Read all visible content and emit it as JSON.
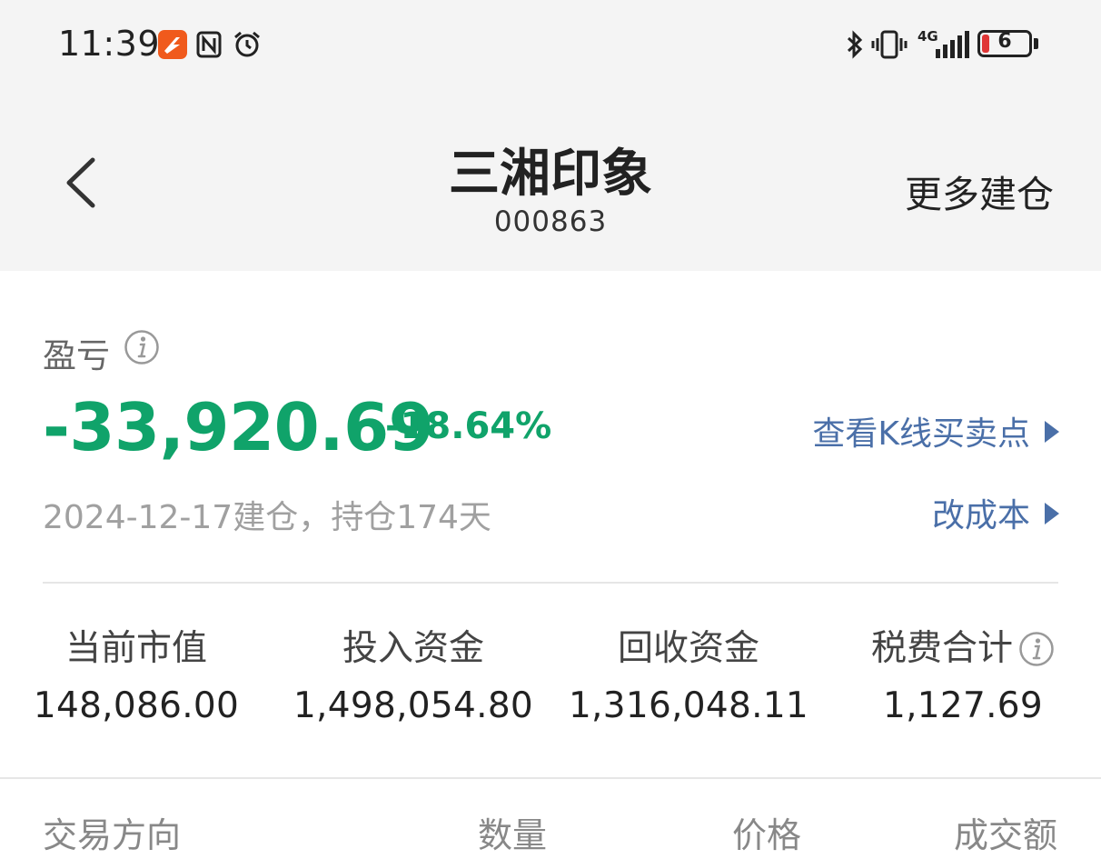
{
  "status_bar": {
    "time": "11:39",
    "network": "4G",
    "battery_level": "6",
    "icons": [
      "app-notification-icon",
      "nfc-icon",
      "alarm-icon",
      "bluetooth-icon",
      "vibrate-icon",
      "signal-icon",
      "battery-icon"
    ]
  },
  "nav": {
    "title": "三湘印象",
    "code": "000863",
    "right_action": "更多建仓"
  },
  "pnl": {
    "label": "盈亏",
    "value": "-33,920.69",
    "percent": "-18.64%",
    "kline_link": "查看K线买卖点",
    "hold_info": "2024-12-17建仓，持仓174天",
    "cost_link": "改成本",
    "color": "#10a36a"
  },
  "stats": [
    {
      "label": "当前市值",
      "value": "148,086.00"
    },
    {
      "label": "投入资金",
      "value": "1,498,054.80"
    },
    {
      "label": "回收资金",
      "value": "1,316,048.11"
    },
    {
      "label": "税费合计",
      "value": "1,127.69"
    }
  ],
  "table": {
    "headers": [
      "交易方向",
      "数量",
      "价格",
      "成交额"
    ]
  },
  "colors": {
    "link": "#4a6fa8",
    "loss": "#10a36a",
    "header_bg": "#f4f4f4"
  }
}
